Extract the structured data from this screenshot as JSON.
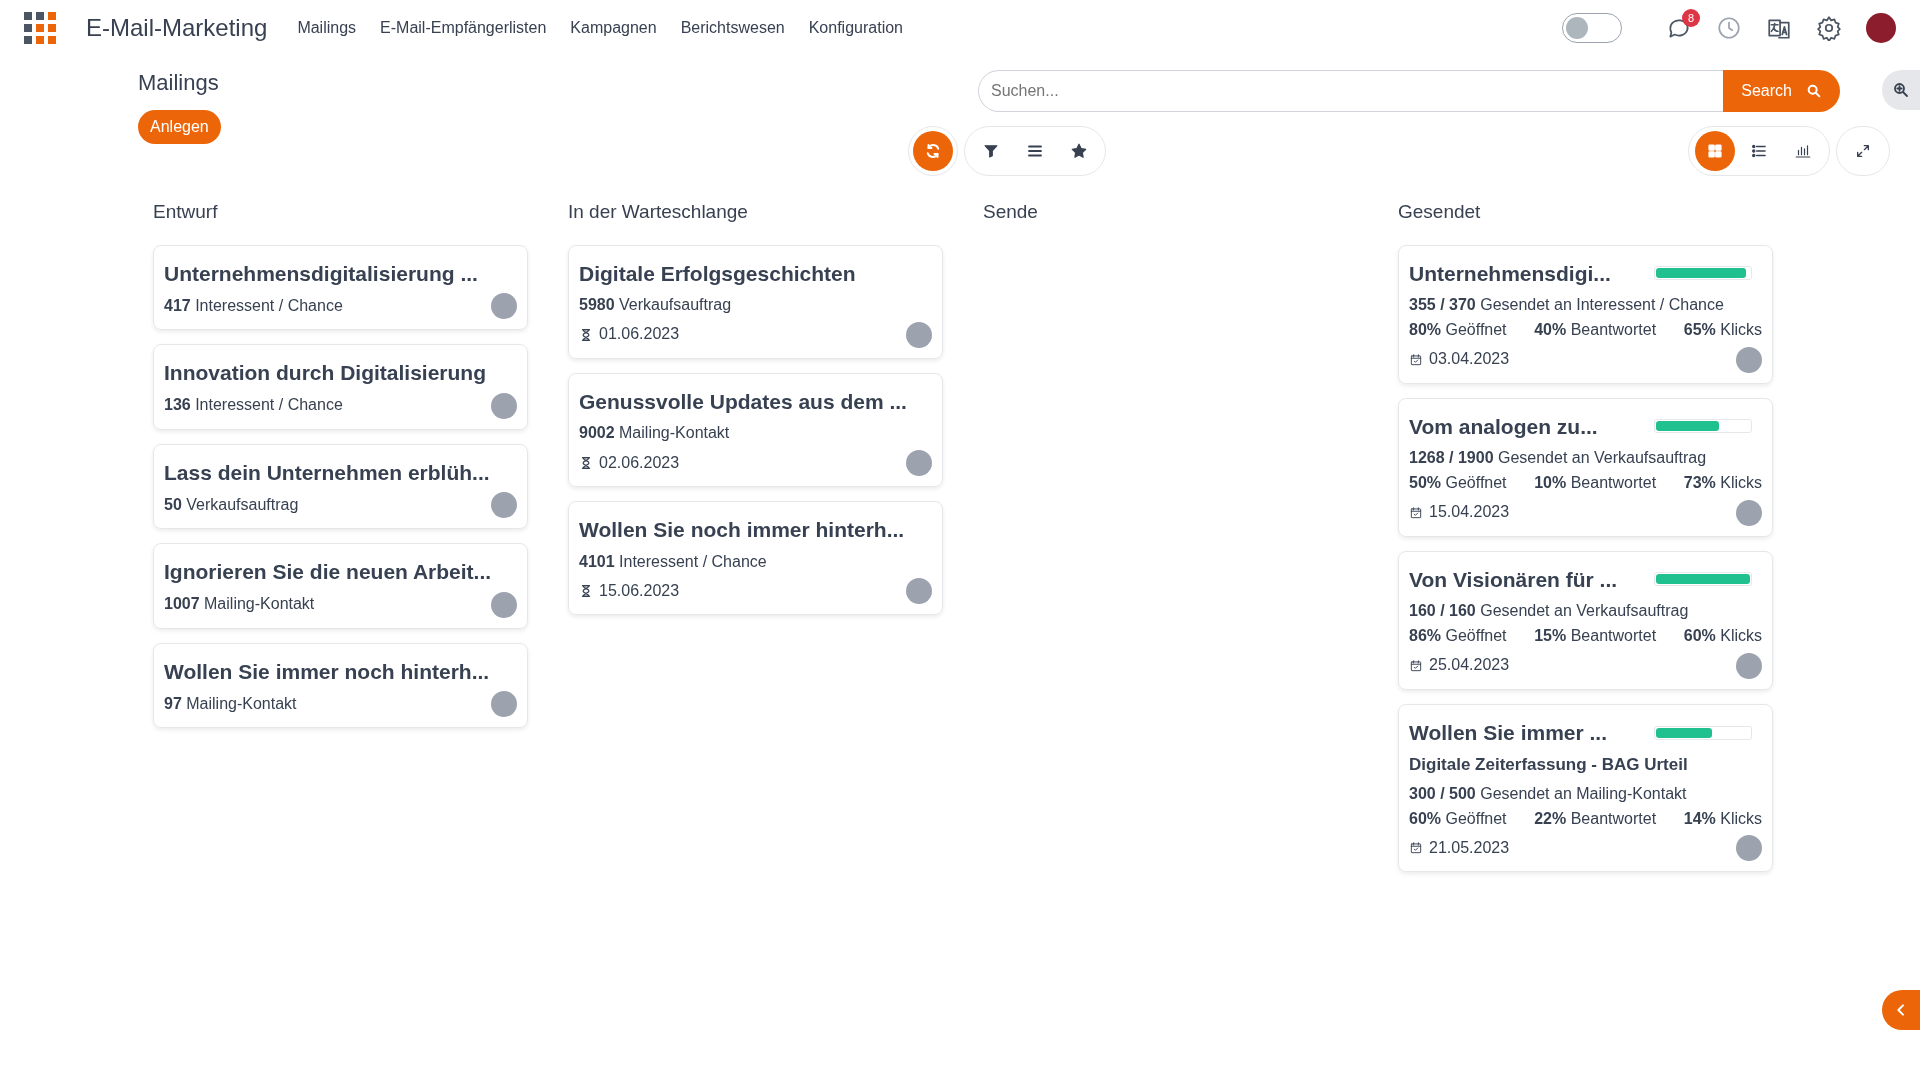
{
  "app": {
    "title": "E-Mail-Marketing",
    "menu": [
      "Mailings",
      "E-Mail-Empfängerlisten",
      "Kampagnen",
      "Berichtswesen",
      "Konfiguration"
    ],
    "toggle_on": false,
    "notifications": "8"
  },
  "page": {
    "title": "Mailings",
    "create_button": "Anlegen",
    "search": {
      "placeholder": "Suchen...",
      "button": "Search"
    }
  },
  "views": [
    {
      "kind": "kanban",
      "selected": true
    },
    {
      "kind": "list",
      "selected": false
    },
    {
      "kind": "graph",
      "selected": false
    }
  ],
  "columns": [
    {
      "title": "Entwurf",
      "cards": [
        {
          "kind": "draft",
          "title": "Unternehmensdigitalisierung ...",
          "lines": [
            "**417** Interessent / Chance"
          ]
        },
        {
          "kind": "draft",
          "title": "Innovation durch Digitalisierung",
          "lines": [
            "**136** Interessent / Chance"
          ]
        },
        {
          "kind": "draft",
          "title": "Lass dein Unternehmen erblüh...",
          "lines": [
            "**50** Verkaufsauftrag"
          ]
        },
        {
          "kind": "draft",
          "title": "Ignorieren Sie die neuen Arbeit...",
          "lines": [
            "**1007** Mailing-Kontakt"
          ]
        },
        {
          "kind": "draft",
          "title": "Wollen Sie immer noch hinterh...",
          "lines": [
            "**97** Mailing-Kontakt"
          ]
        }
      ]
    },
    {
      "title": "In der Warteschlange",
      "cards": [
        {
          "kind": "scheduled",
          "title": "Digitale Erfolgsgeschichten",
          "lines": [
            "**5980** Verkaufsauftrag"
          ],
          "date": "01.06.2023"
        },
        {
          "kind": "scheduled",
          "title": "Genussvolle Updates aus dem ...",
          "lines": [
            "**9002** Mailing-Kontakt"
          ],
          "date": "02.06.2023"
        },
        {
          "kind": "scheduled",
          "title": "Wollen Sie noch immer hinterh...",
          "lines": [
            "**4101** Interessent / Chance"
          ],
          "date": "15.06.2023"
        }
      ]
    },
    {
      "title": "Sende"
    },
    {
      "title": "Gesendet",
      "cards": [
        {
          "kind": "sent",
          "title": "Unternehmensdigi...",
          "level": 0.96,
          "lines": [
            "**355 / 370** Gesendet an Interessent / Chance"
          ],
          "stats": [
            "**80%** Geöffnet",
            "**40%** Beantwortet",
            "**65%** Klicks"
          ],
          "date": "03.04.2023"
        },
        {
          "kind": "sent",
          "title": "Vom analogen zu...",
          "level": 0.67,
          "lines": [
            "**1268 / 1900** Gesendet an Verkaufsauftrag"
          ],
          "stats": [
            "**50%** Geöffnet",
            "**10%** Beantwortet",
            "**73%** Klicks"
          ],
          "date": "15.04.2023"
        },
        {
          "kind": "sent",
          "title": "Von Visionären für ...",
          "level": 1,
          "lines": [
            "**160 / 160** Gesendet an Verkaufsauftrag"
          ],
          "stats": [
            "**86%** Geöffnet",
            "**15%** Beantwortet",
            "**60%** Klicks"
          ],
          "date": "25.04.2023"
        },
        {
          "kind": "sent",
          "title": "Wollen Sie immer ...",
          "level": 0.6,
          "subtitle": "Digitale Zeiterfassung - BAG Urteil",
          "lines": [
            "**300 / 500** Gesendet an Mailing-Kontakt"
          ],
          "stats": [
            "**60%** Geöffnet",
            "**22%** Beantwortet",
            "**14%** Klicks"
          ],
          "date": "21.05.2023"
        }
      ]
    }
  ]
}
